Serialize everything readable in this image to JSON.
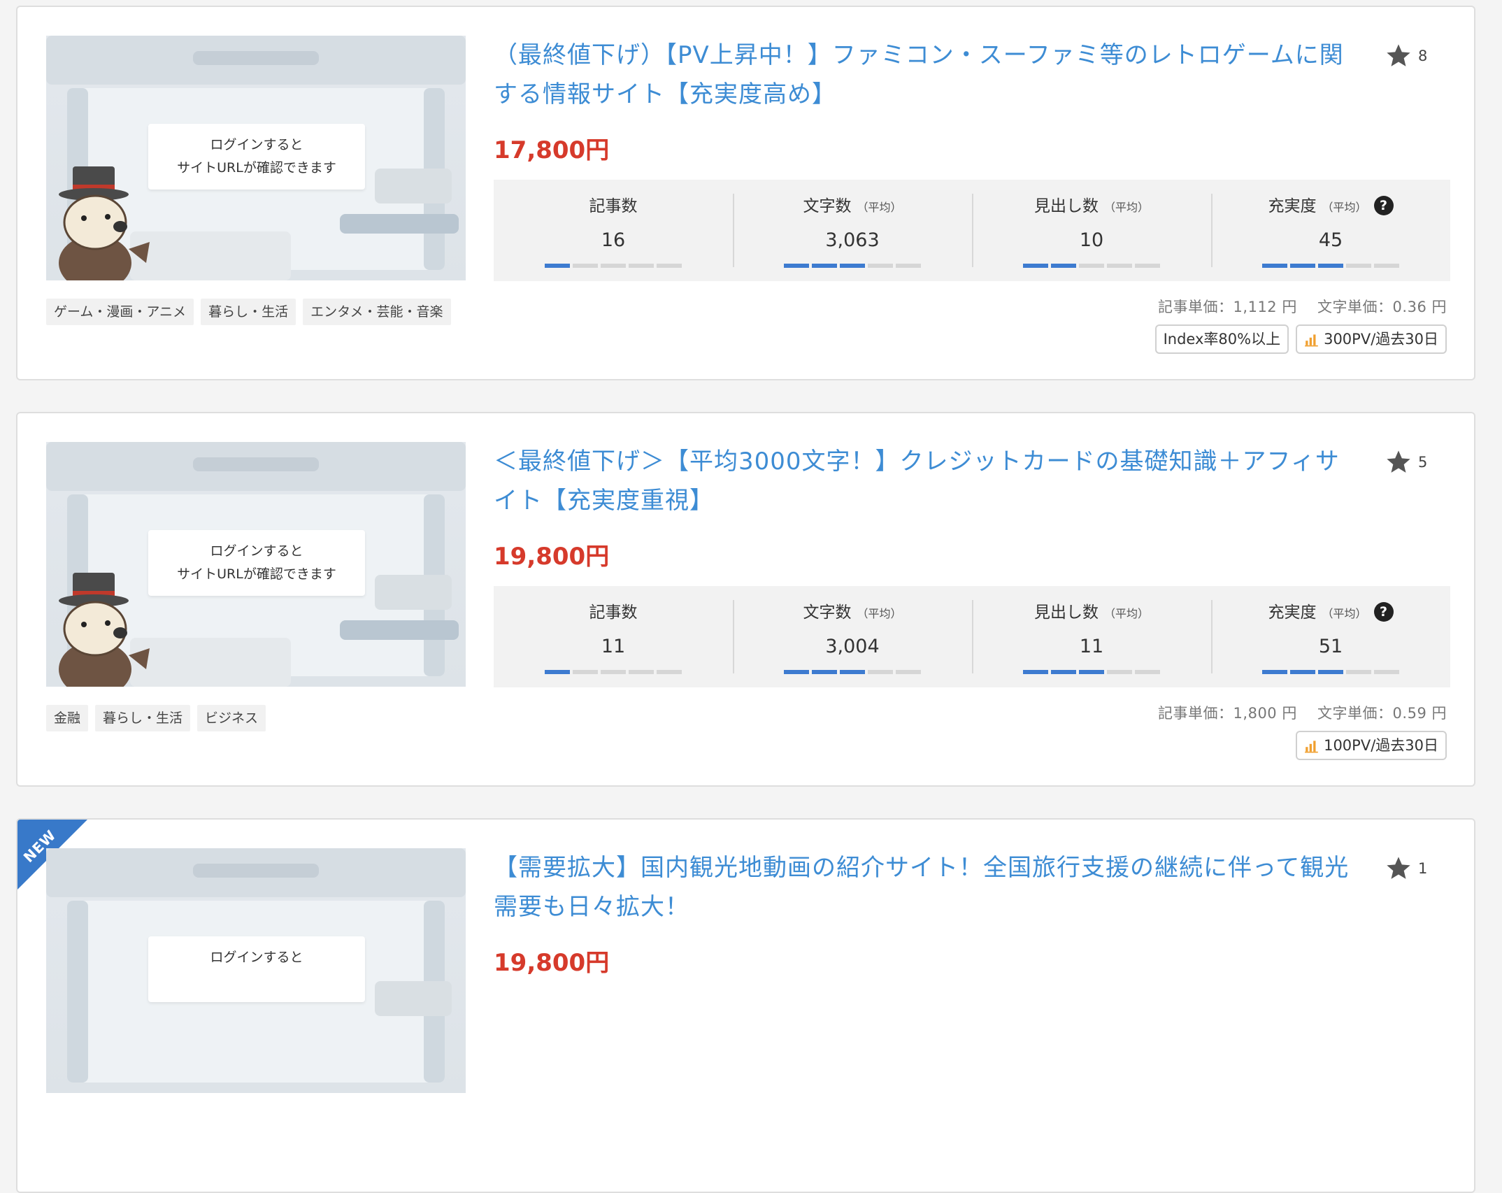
{
  "login_notice_line1": "ログインすると",
  "login_notice_line2": "サイトURLが確認できます",
  "stat_labels": {
    "articles": "記事数",
    "chars": "文字数",
    "headings": "見出し数",
    "quality": "充実度",
    "avg": "（平均）",
    "help": "?"
  },
  "unit_labels": {
    "article_price": "記事単価：",
    "char_price": "文字単価：",
    "yen": "円"
  },
  "listings": [
    {
      "title": "（最終値下げ）【PV上昇中！】ファミコン・スーファミ等のレトロゲームに関する情報サイト【充実度高め】",
      "favorites": "8",
      "price": "17,800円",
      "tags": [
        "ゲーム・漫画・アニメ",
        "暮らし・生活",
        "エンタメ・芸能・音楽"
      ],
      "stats": {
        "articles": "16",
        "articles_level": 1,
        "chars": "3,063",
        "chars_level": 3,
        "headings": "10",
        "headings_level": 2,
        "quality": "45",
        "quality_level": 3
      },
      "article_price": "1,112",
      "char_price": "0.36",
      "badges": {
        "index": "Index率80%以上",
        "pv": "300PV/過去30日"
      }
    },
    {
      "title": "＜最終値下げ＞【平均3000文字！】クレジットカードの基礎知識＋アフィサイト【充実度重視】",
      "favorites": "5",
      "price": "19,800円",
      "tags": [
        "金融",
        "暮らし・生活",
        "ビジネス"
      ],
      "stats": {
        "articles": "11",
        "articles_level": 1,
        "chars": "3,004",
        "chars_level": 3,
        "headings": "11",
        "headings_level": 3,
        "quality": "51",
        "quality_level": 3
      },
      "article_price": "1,800",
      "char_price": "0.59",
      "badges": {
        "pv": "100PV/過去30日"
      }
    },
    {
      "badge_new": "NEW",
      "title": "【需要拡大】国内観光地動画の紹介サイト！全国旅行支援の継続に伴って観光需要も日々拡大！",
      "favorites": "1",
      "price": "19,800円"
    }
  ],
  "colors": {
    "title": "#3d8cd4",
    "price": "#d63a2b",
    "bar_on": "#3d7bd0",
    "new_ribbon": "#3879c9",
    "pv_icon": "#f0a030"
  }
}
